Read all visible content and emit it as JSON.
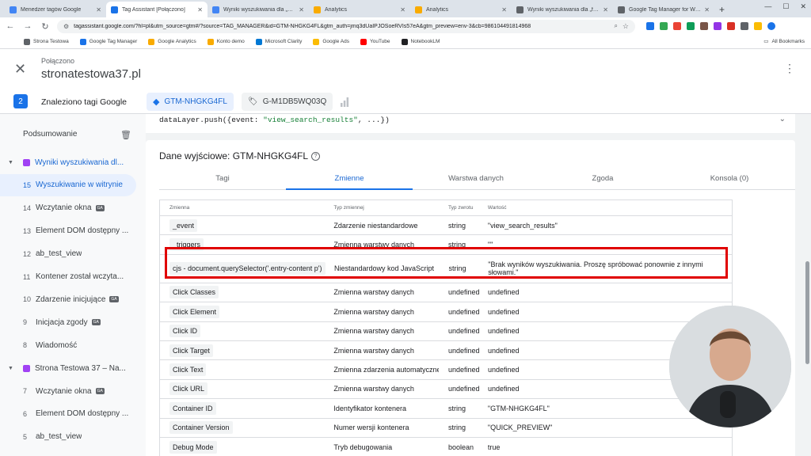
{
  "browser": {
    "tabs": [
      {
        "label": "Menedżer tagów Google",
        "color": "#4285f4"
      },
      {
        "label": "Tag Assistant [Połączono]",
        "color": "#1a73e8",
        "active": true
      },
      {
        "label": "Wyniki wyszukiwania dla „pier...",
        "color": "#4285f4"
      },
      {
        "label": "Analytics",
        "color": "#f9ab00"
      },
      {
        "label": "Analytics",
        "color": "#f9ab00"
      },
      {
        "label": "Wyniki wyszukiwania dla „frazy...",
        "color": "#5f6368"
      },
      {
        "label": "Google Tag Manager for Word...",
        "color": "#5f6368"
      }
    ],
    "url": "tagassistant.google.com/?hl=pl&utm_source=gtm#/?source=TAG_MANAGER&id=GTM-NHGKG4FL&gtm_auth=jmq3dUaIPJOSoeRVIs57eA&gtm_preview=env-3&cb=986104491814968",
    "bookmarks": [
      {
        "label": "Strona Testowa",
        "color": "#5f6368"
      },
      {
        "label": "Google Tag Manager",
        "color": "#1a73e8"
      },
      {
        "label": "Google Analytics",
        "color": "#f9ab00"
      },
      {
        "label": "Konto demo",
        "color": "#f9ab00"
      },
      {
        "label": "Microsoft Clarity",
        "color": "#0078d4"
      },
      {
        "label": "Google Ads",
        "color": "#fbbc04"
      },
      {
        "label": "YouTube",
        "color": "#ff0000"
      },
      {
        "label": "NotebookLM",
        "color": "#202124"
      }
    ],
    "all_bookmarks": "All Bookmarks"
  },
  "header": {
    "status": "Połączono",
    "site": "stronatestowa37.pl"
  },
  "tagsbar": {
    "count": "2",
    "found_label": "Znaleziono tagi Google",
    "gtm_chip": "GTM-NHGKG4FL",
    "ga_chip": "G-M1DB5WQ03Q"
  },
  "sidebar": {
    "summary": "Podsumowanie",
    "items": [
      {
        "type": "group",
        "label": "Wyniki wyszukiwania dl..."
      },
      {
        "num": "15",
        "label": "Wyszukiwanie w witrynie",
        "selected": true
      },
      {
        "num": "14",
        "label": "Wczytanie okna",
        "badge": true
      },
      {
        "num": "13",
        "label": "Element DOM dostępny ..."
      },
      {
        "num": "12",
        "label": "ab_test_view"
      },
      {
        "num": "11",
        "label": "Kontener został wczyta..."
      },
      {
        "num": "10",
        "label": "Zdarzenie inicjujące",
        "badge": true
      },
      {
        "num": "9",
        "label": "Inicjacja zgody",
        "badge": true
      },
      {
        "num": "8",
        "label": "Wiadomość"
      },
      {
        "type": "group",
        "label": "Strona Testowa 37 – Na..."
      },
      {
        "num": "7",
        "label": "Wczytanie okna",
        "badge": true
      },
      {
        "num": "6",
        "label": "Element DOM dostępny ..."
      },
      {
        "num": "5",
        "label": "ab_test_view"
      }
    ],
    "badge_label": "GA"
  },
  "code": {
    "prefix": "dataLayer.push({event: ",
    "event": "\"view_search_results\"",
    "suffix": ", ...})"
  },
  "output": {
    "title": "Dane wyjściowe: GTM-NHGKG4FL",
    "tabs": [
      "Tagi",
      "Zmienne",
      "Warstwa danych",
      "Zgoda",
      "Konsola (0)"
    ],
    "active_tab": 1,
    "columns": [
      "Zmienna",
      "Typ zmiennej",
      "Typ zwrotu",
      "Wartość"
    ],
    "rows": [
      {
        "name": "_event",
        "type": "Zdarzenie niestandardowe",
        "ret": "string",
        "value": "\"view_search_results\""
      },
      {
        "name": "_triggers",
        "type": "Zmienna warstwy danych",
        "ret": "string",
        "value": "\"\""
      },
      {
        "name": "cjs - document.querySelector('.entry-content p')",
        "type": "Niestandardowy kod JavaScript",
        "ret": "string",
        "value": "\"Brak wyników wyszukiwania. Proszę spróbować ponownie z innymi słowami.\"",
        "tall": true
      },
      {
        "name": "Click Classes",
        "type": "Zmienna warstwy danych",
        "ret": "undefined",
        "value": "undefined"
      },
      {
        "name": "Click Element",
        "type": "Zmienna warstwy danych",
        "ret": "undefined",
        "value": "undefined"
      },
      {
        "name": "Click ID",
        "type": "Zmienna warstwy danych",
        "ret": "undefined",
        "value": "undefined"
      },
      {
        "name": "Click Target",
        "type": "Zmienna warstwy danych",
        "ret": "undefined",
        "value": "undefined"
      },
      {
        "name": "Click Text",
        "type": "Zmienna zdarzenia automatyczne",
        "ret": "undefined",
        "value": "undefined"
      },
      {
        "name": "Click URL",
        "type": "Zmienna warstwy danych",
        "ret": "undefined",
        "value": "undefined"
      },
      {
        "name": "Container ID",
        "type": "Identyfikator kontenera",
        "ret": "string",
        "value": "\"GTM-NHGKG4FL\""
      },
      {
        "name": "Container Version",
        "type": "Numer wersji kontenera",
        "ret": "string",
        "value": "\"QUICK_PREVIEW\""
      },
      {
        "name": "Debug Mode",
        "type": "Tryb debugowania",
        "ret": "boolean",
        "value": "true"
      }
    ]
  },
  "colors": {
    "accent": "#1a73e8",
    "highlight": "#e00000"
  }
}
